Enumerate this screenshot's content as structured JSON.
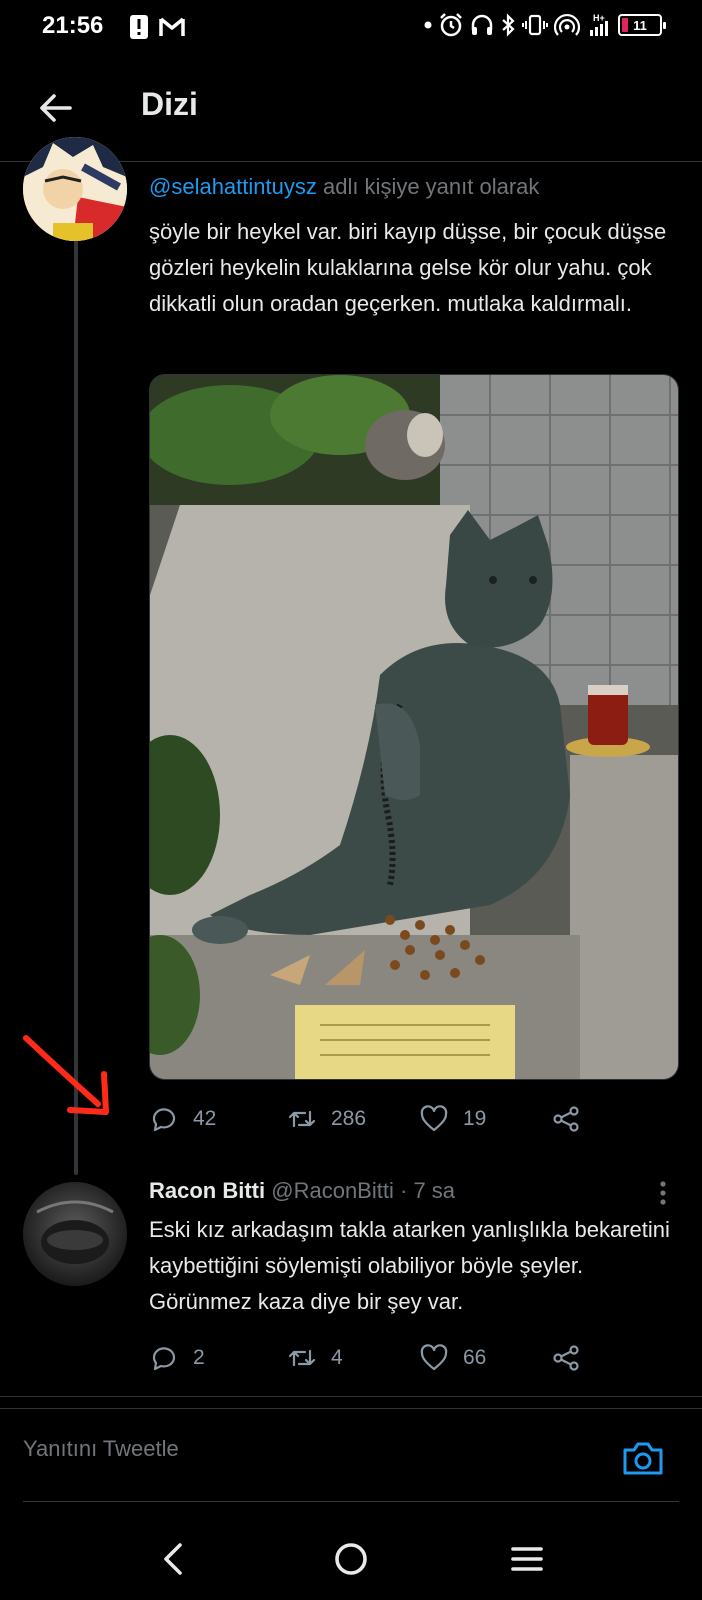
{
  "status_bar": {
    "time": "21:56",
    "left_icons": [
      "alert-icon",
      "gmail-icon"
    ],
    "right_icons": [
      "dot-icon",
      "alarm-icon",
      "headphones-icon",
      "bluetooth-icon",
      "vibrate-icon",
      "hotspot-icon",
      "signal-icon"
    ],
    "network": "H+",
    "battery": "11"
  },
  "header": {
    "title": "Dizi"
  },
  "tweet1": {
    "reply_mention": "@selahattintuysz",
    "reply_suffix": " adlı kişiye yanıt olarak",
    "text": "şöyle bir heykel var. biri kayıp düşse, bir çocuk düşse gözleri heykelin kulaklarına gelse kör olur yahu. çok dikkatli olun oradan geçerken. mutlaka kaldırmalı.",
    "media": "cat-statue-photo",
    "replies": "42",
    "retweets": "286",
    "likes": "19"
  },
  "tweet2": {
    "name": "Racon Bitti",
    "handle": "@RaconBitti",
    "separator": "·",
    "time": "7 sa",
    "text": "Eski kız arkadaşım takla atarken yanlışlıkla bekaretini kaybettiğini söylemişti olabiliyor böyle şeyler.  Görünmez kaza diye bir şey var.",
    "replies": "2",
    "retweets": "4",
    "likes": "66"
  },
  "compose": {
    "placeholder": "Yanıtını Tweetle"
  },
  "colors": {
    "background": "#000000",
    "text": "#e7e9ea",
    "muted": "#71767b",
    "accent": "#1d9bf0",
    "annotation_arrow": "#ff2a1a"
  }
}
